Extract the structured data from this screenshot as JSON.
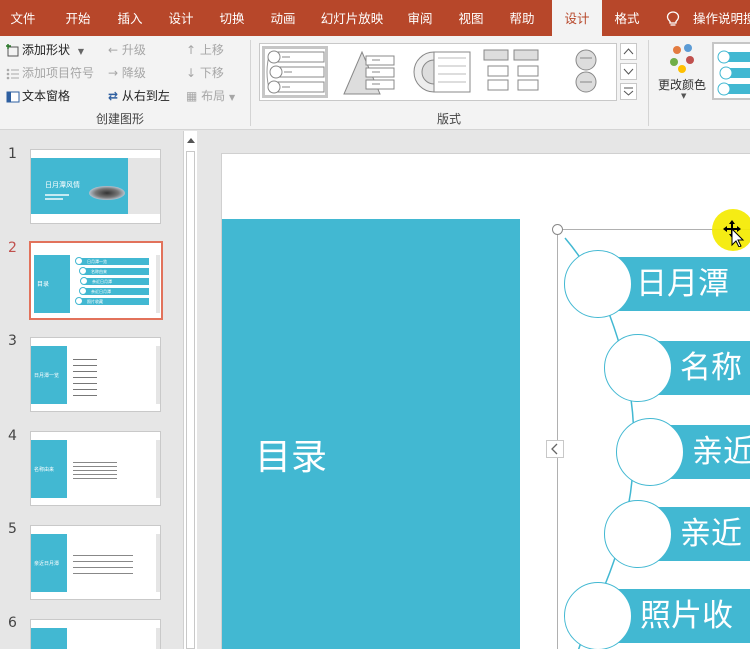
{
  "tabs": [
    {
      "label": "文件",
      "active": false
    },
    {
      "label": "开始",
      "active": false
    },
    {
      "label": "插入",
      "active": false
    },
    {
      "label": "设计",
      "active": false
    },
    {
      "label": "切换",
      "active": false
    },
    {
      "label": "动画",
      "active": false
    },
    {
      "label": "幻灯片放映",
      "active": false
    },
    {
      "label": "审阅",
      "active": false
    },
    {
      "label": "视图",
      "active": false
    },
    {
      "label": "帮助",
      "active": false
    },
    {
      "label": "设计",
      "active": true
    },
    {
      "label": "格式",
      "active": false
    }
  ],
  "tell_me": "操作说明搜",
  "ribbon": {
    "create_graphic": {
      "add_shape": "添加形状",
      "add_bullet": "添加项目符号",
      "text_pane": "文本窗格",
      "promote": "升级",
      "demote": "降级",
      "right_to_left": "从右到左",
      "move_up": "上移",
      "move_down": "下移",
      "layout": "布局",
      "group_label": "创建图形"
    },
    "layouts": {
      "group_label": "版式"
    },
    "change_colors": "更改颜色"
  },
  "slides": [
    {
      "number": "1",
      "title": "日月潭风情"
    },
    {
      "number": "2",
      "title": "目录",
      "items": [
        "日月潭一览",
        "名称由来",
        "亲近日月潭",
        "亲近日月潭",
        "照片收藏"
      ]
    },
    {
      "number": "3",
      "title": "日月潭一览"
    },
    {
      "number": "4",
      "title": "名称由来"
    },
    {
      "number": "5",
      "title": "亲近日月潭"
    },
    {
      "number": "6",
      "title": ""
    }
  ],
  "current_slide": {
    "title": "目录",
    "items": [
      "日月潭",
      "名称",
      "亲近",
      "亲近",
      "照片收"
    ]
  },
  "colors": {
    "accent": "#b7472a",
    "teal": "#42b8d2",
    "active_thumb": "#e2725b",
    "cursor_highlight": "#f4ea00"
  }
}
